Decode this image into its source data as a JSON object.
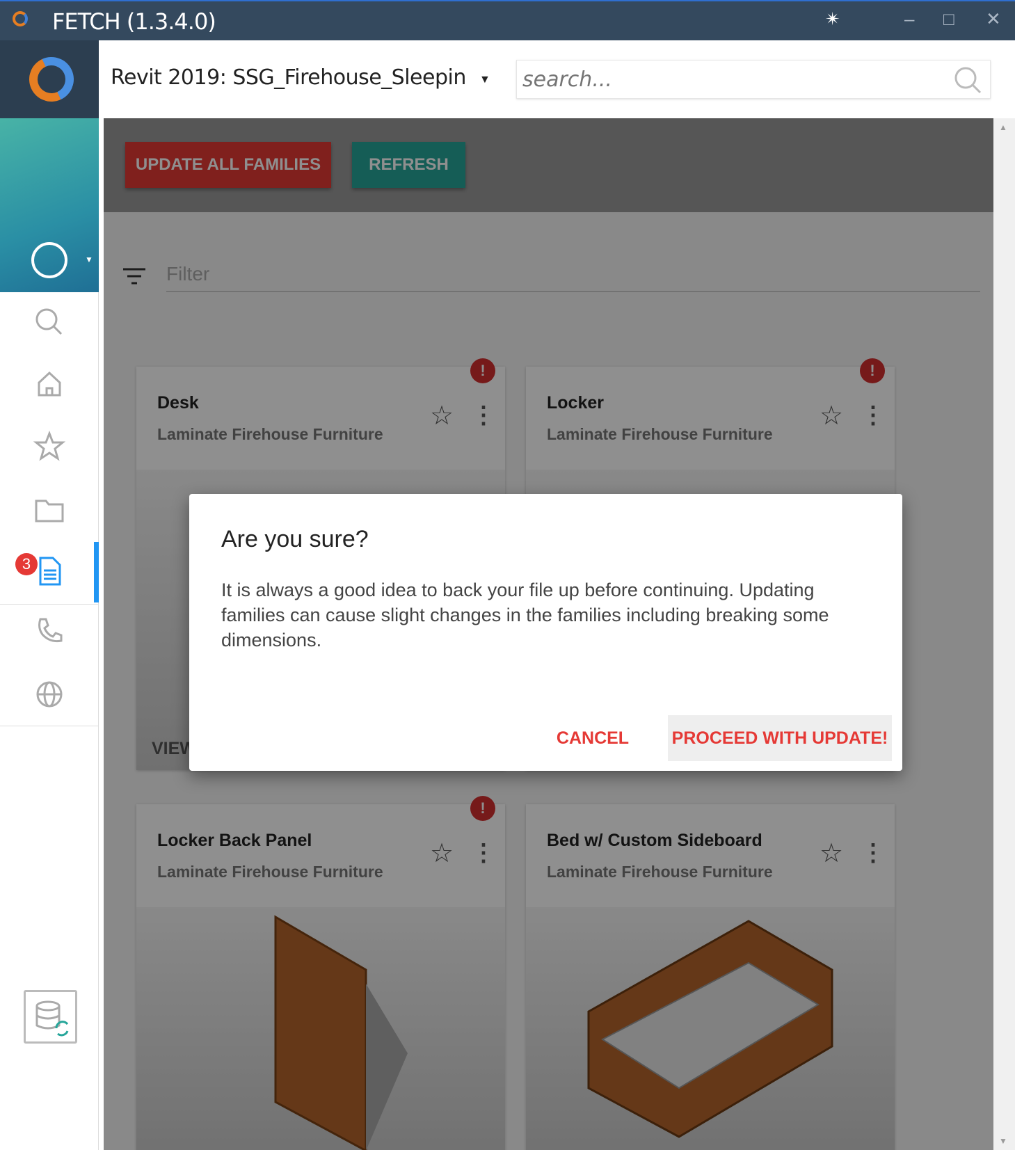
{
  "window": {
    "title": "FETCH (1.3.4.0)",
    "controls": [
      "pin",
      "minimize",
      "maximize",
      "close"
    ]
  },
  "sidebar": {
    "badge_count": "3",
    "items": [
      "search",
      "home",
      "favorites",
      "folder",
      "documents",
      "support",
      "web"
    ],
    "active": "documents"
  },
  "header": {
    "project": "Revit 2019: SSG_Firehouse_Sleepin",
    "search_placeholder": "search..."
  },
  "toolbar": {
    "update_all": "UPDATE ALL FAMILIES",
    "refresh": "REFRESH"
  },
  "filter": {
    "placeholder": "Filter"
  },
  "cards": [
    {
      "name": "Desk",
      "category": "Laminate Firehouse Furniture",
      "alert": "!",
      "view": "VIEW"
    },
    {
      "name": "Locker",
      "category": "Laminate Firehouse Furniture",
      "alert": "!"
    },
    {
      "name": "Locker Back Panel",
      "category": "Laminate Firehouse Furniture",
      "alert": "!"
    },
    {
      "name": "Bed w/ Custom Sideboard",
      "category": "Laminate Firehouse Furniture"
    }
  ],
  "dialog": {
    "title": "Are you sure?",
    "message": "It is always a good idea to back your file up before continuing. Updating families can cause slight changes in the families including breaking some dimensions.",
    "cancel": "CANCEL",
    "proceed": "PROCEED WITH UPDATE!"
  },
  "colors": {
    "titlebar": "#34495e",
    "danger": "#d32f2f",
    "teal": "#26a69a",
    "accent": "#2196f3"
  }
}
